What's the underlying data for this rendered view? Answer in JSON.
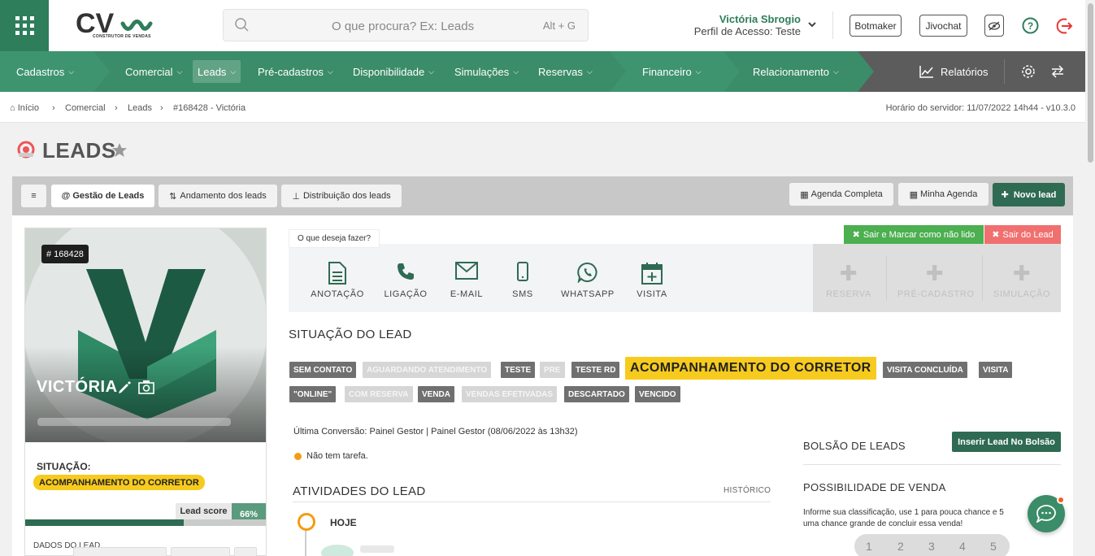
{
  "header": {
    "logo_text": "CV",
    "logo_sub": "CONSTRUTOR DE VENDAS",
    "search_placeholder": "O que procura? Ex: Leads",
    "search_shortcut": "Alt + G",
    "user_name": "Victória Sbrogio",
    "user_profile": "Perfil de Acesso: Teste",
    "btn_botmaker": "Botmaker",
    "btn_jivochat": "Jivochat"
  },
  "nav": {
    "items": [
      {
        "label": "Cadastros"
      },
      {
        "label": "Comercial"
      },
      {
        "label": "Leads"
      },
      {
        "label": "Pré-cadastros"
      },
      {
        "label": "Disponibilidade"
      },
      {
        "label": "Simulações"
      },
      {
        "label": "Reservas"
      },
      {
        "label": "Financeiro"
      },
      {
        "label": "Relacionamento"
      }
    ],
    "reports": "Relatórios"
  },
  "breadcrumb": {
    "home": "Início",
    "items": [
      "Comercial",
      "Leads",
      "#168428 - Victória"
    ],
    "server_time": "Horário do servidor: 11/07/2022 14h44 - v10.3.0"
  },
  "page_title": "LEADS",
  "toolbar": {
    "menu": "≡",
    "tabs": [
      "@ Gestão de Leads",
      "Andamento dos leads",
      "Distribuição dos leads"
    ],
    "agenda_completa": "Agenda Completa",
    "minha_agenda": "Minha Agenda",
    "novo_lead": "Novo lead"
  },
  "lead": {
    "id_badge": "# 168428",
    "name": "VICTÓRIA",
    "situation_label": "SITUAÇÃO:",
    "situation": "ACOMPANHAMENTO DO CORRETOR",
    "score_label": "Lead score",
    "score_value": "66%",
    "score_fraction": 0.66,
    "dados_label": "DADOS DO LEAD"
  },
  "actions": {
    "prompt": "O que deseja fazer?",
    "exit_unread": "Sair e Marcar como não lido",
    "exit_lead": "Sair do Lead",
    "items": [
      "ANOTAÇÃO",
      "LIGAÇÃO",
      "E-MAIL",
      "SMS",
      "WHATSAPP",
      "VISITA"
    ],
    "disabled": [
      "RESERVA",
      "PRÉ-CADASTRO",
      "SIMULAÇÃO"
    ]
  },
  "situacao": {
    "title": "SITUAÇÃO DO LEAD",
    "row1": [
      "SEM CONTATO",
      "AGUARDANDO ATENDIMENTO",
      "TESTE",
      "PRE",
      "TESTE RD",
      "ACOMPANHAMENTO DO CORRETOR",
      "VISITA CONCLUÍDA",
      "VISITA"
    ],
    "row2": [
      "\"ONLINE\"",
      "COM RESERVA",
      "VENDA",
      "VENDAS EFETIVADAS",
      "DESCARTADO",
      "VENCIDO"
    ]
  },
  "info": {
    "last_conversion": "Última Conversão: Painel Gestor | Painel Gestor (08/06/2022 às 13h32)",
    "no_task": "Não tem tarefa."
  },
  "activities": {
    "title": "ATIVIDADES DO LEAD",
    "history": "HISTÓRICO",
    "today": "HOJE"
  },
  "side": {
    "bolsao_title": "BOLSÃO DE LEADS",
    "inserir": "Inserir Lead No Bolsão",
    "possibilidade_title": "POSSIBILIDADE DE VENDA",
    "possibilidade_text1": "Informe sua classificação, use 1 para pouca chance e 5",
    "possibilidade_text2": "uma chance grande de concluir essa venda!",
    "ratings": [
      "1",
      "2",
      "3",
      "4",
      "5"
    ]
  },
  "colors": {
    "brand_green": "#3b8c68",
    "dark_green": "#2e6b52",
    "highlight_yellow": "#f7cb1e",
    "exit_red": "#f07070",
    "exit_green": "#4caf50"
  }
}
